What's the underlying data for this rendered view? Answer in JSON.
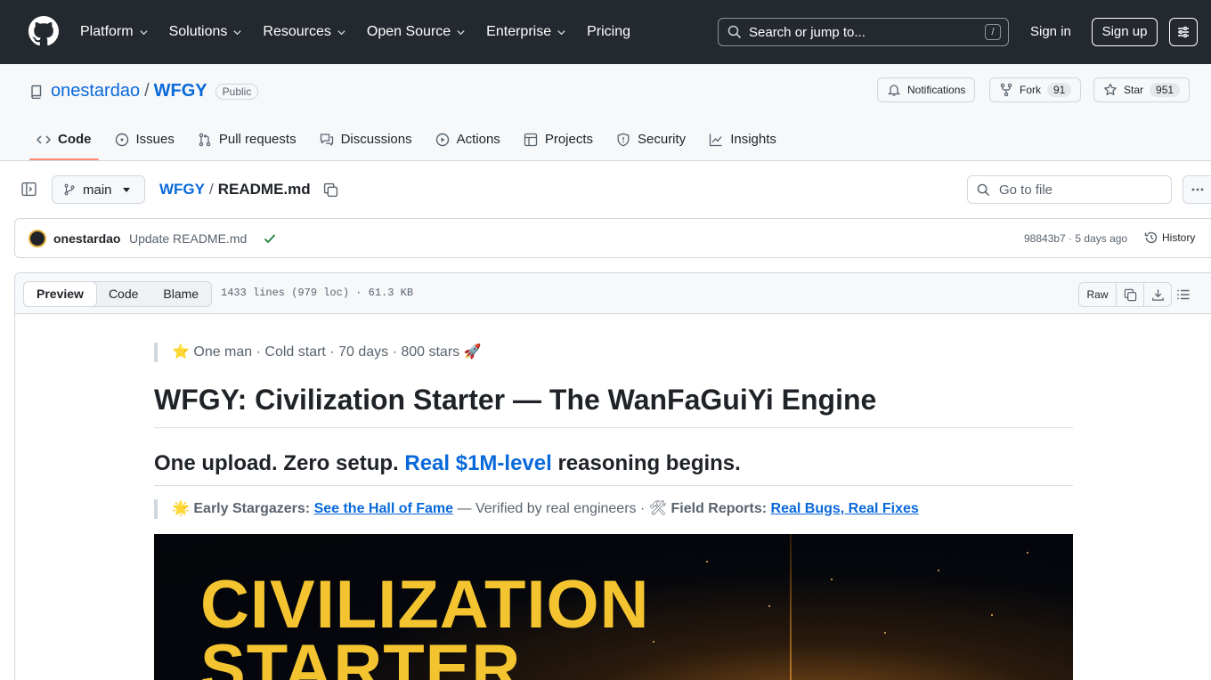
{
  "header": {
    "nav": [
      "Platform",
      "Solutions",
      "Resources",
      "Open Source",
      "Enterprise",
      "Pricing"
    ],
    "search_placeholder": "Search or jump to...",
    "search_shortcut": "/",
    "sign_in": "Sign in",
    "sign_up": "Sign up"
  },
  "repo": {
    "owner": "onestardao",
    "name": "WFGY",
    "visibility": "Public",
    "notifications_label": "Notifications",
    "fork_label": "Fork",
    "fork_count": "91",
    "star_label": "Star",
    "star_count": "951",
    "tabs": [
      "Code",
      "Issues",
      "Pull requests",
      "Discussions",
      "Actions",
      "Projects",
      "Security",
      "Insights"
    ]
  },
  "file": {
    "branch": "main",
    "repo_crumb": "WFGY",
    "filename": "README.md",
    "goto_placeholder": "Go to file",
    "meta": "1433 lines (979 loc) · 61.3 KB",
    "view_modes": [
      "Preview",
      "Code",
      "Blame"
    ],
    "raw_label": "Raw"
  },
  "commit": {
    "author": "onestardao",
    "message": "Update README.md",
    "hash_time": "98843b7 · 5 days ago",
    "history_label": "History"
  },
  "readme": {
    "tagline": "⭐️ One man · Cold start · 70 days · 800 stars 🚀",
    "h1": "WFGY: Civilization Starter — The WanFaGuiYi Engine",
    "h2_prefix": "One upload. Zero setup. ",
    "h2_link": "Real $1M-level",
    "h2_suffix": " reasoning begins.",
    "q_icon1": "🌟",
    "q_label1": "Early Stargazers:",
    "q_link1": "See the Hall of Fame",
    "q_mid": "— Verified by real engineers ·",
    "q_icon2": "🛠",
    "q_label2": "Field Reports:",
    "q_link2": "Real Bugs, Real Fixes",
    "banner_line1": "CIVILIZATION",
    "banner_line2": "STARTER"
  },
  "colors": {
    "header_bg": "#24292f",
    "link": "#0969da",
    "active_tab_underline": "#fd8c73",
    "banner_text": "#f4c430"
  }
}
